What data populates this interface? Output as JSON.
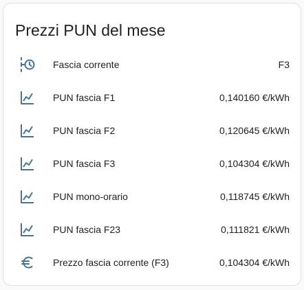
{
  "card": {
    "title": "Prezzi PUN del mese",
    "rows": [
      {
        "label": "Fascia corrente",
        "value": "F3",
        "icon": "clock-timeline-icon"
      },
      {
        "label": "PUN fascia F1",
        "value": "0,140160 €/kWh",
        "icon": "chart-line-icon"
      },
      {
        "label": "PUN fascia F2",
        "value": "0,120645 €/kWh",
        "icon": "chart-line-icon"
      },
      {
        "label": "PUN fascia F3",
        "value": "0,104304 €/kWh",
        "icon": "chart-line-icon"
      },
      {
        "label": "PUN mono-orario",
        "value": "0,118745 €/kWh",
        "icon": "chart-line-icon"
      },
      {
        "label": "PUN fascia F23",
        "value": "0,111821 €/kWh",
        "icon": "chart-line-icon"
      },
      {
        "label": "Prezzo fascia corrente (F3)",
        "value": "0,104304 €/kWh",
        "icon": "euro-icon"
      }
    ]
  },
  "colors": {
    "icon": "#44739e",
    "text": "#212121",
    "card_background": "#ffffff",
    "page_background": "#fafafa"
  }
}
